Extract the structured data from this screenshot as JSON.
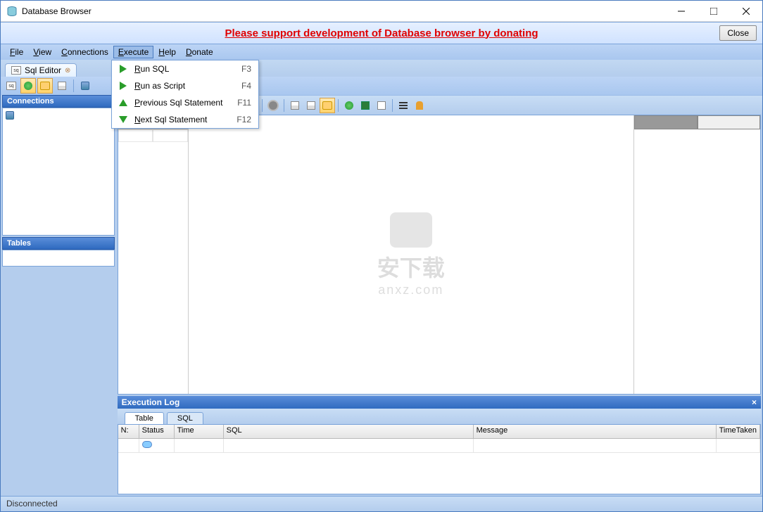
{
  "window": {
    "title": "Database Browser"
  },
  "banner": {
    "text": "Please support development of Database browser by donating",
    "close": "Close"
  },
  "menu": {
    "file": "File",
    "view": "View",
    "connections": "Connections",
    "execute": "Execute",
    "help": "Help",
    "donate": "Donate"
  },
  "execute_menu": {
    "run_sql": {
      "label": "Run SQL",
      "shortcut": "F3"
    },
    "run_script": {
      "label": "Run as Script",
      "shortcut": "F4"
    },
    "prev_stmt": {
      "label": "Previous Sql Statement",
      "shortcut": "F11"
    },
    "next_stmt": {
      "label": "Next Sql Statement",
      "shortcut": "F12"
    }
  },
  "tabs": {
    "sql_editor": "Sql Editor"
  },
  "panes": {
    "connections": "Connections",
    "tables": "Tables"
  },
  "exec_log": {
    "title": "Execution Log",
    "tab_table": "Table",
    "tab_sql": "SQL",
    "cols": {
      "n": "N:",
      "status": "Status",
      "time": "Time",
      "sql": "SQL",
      "message": "Message",
      "timetaken": "TimeTaken"
    }
  },
  "statusbar": {
    "status": "Disconnected"
  },
  "watermark": {
    "line1": "安下载",
    "line2": "anxz.com"
  }
}
